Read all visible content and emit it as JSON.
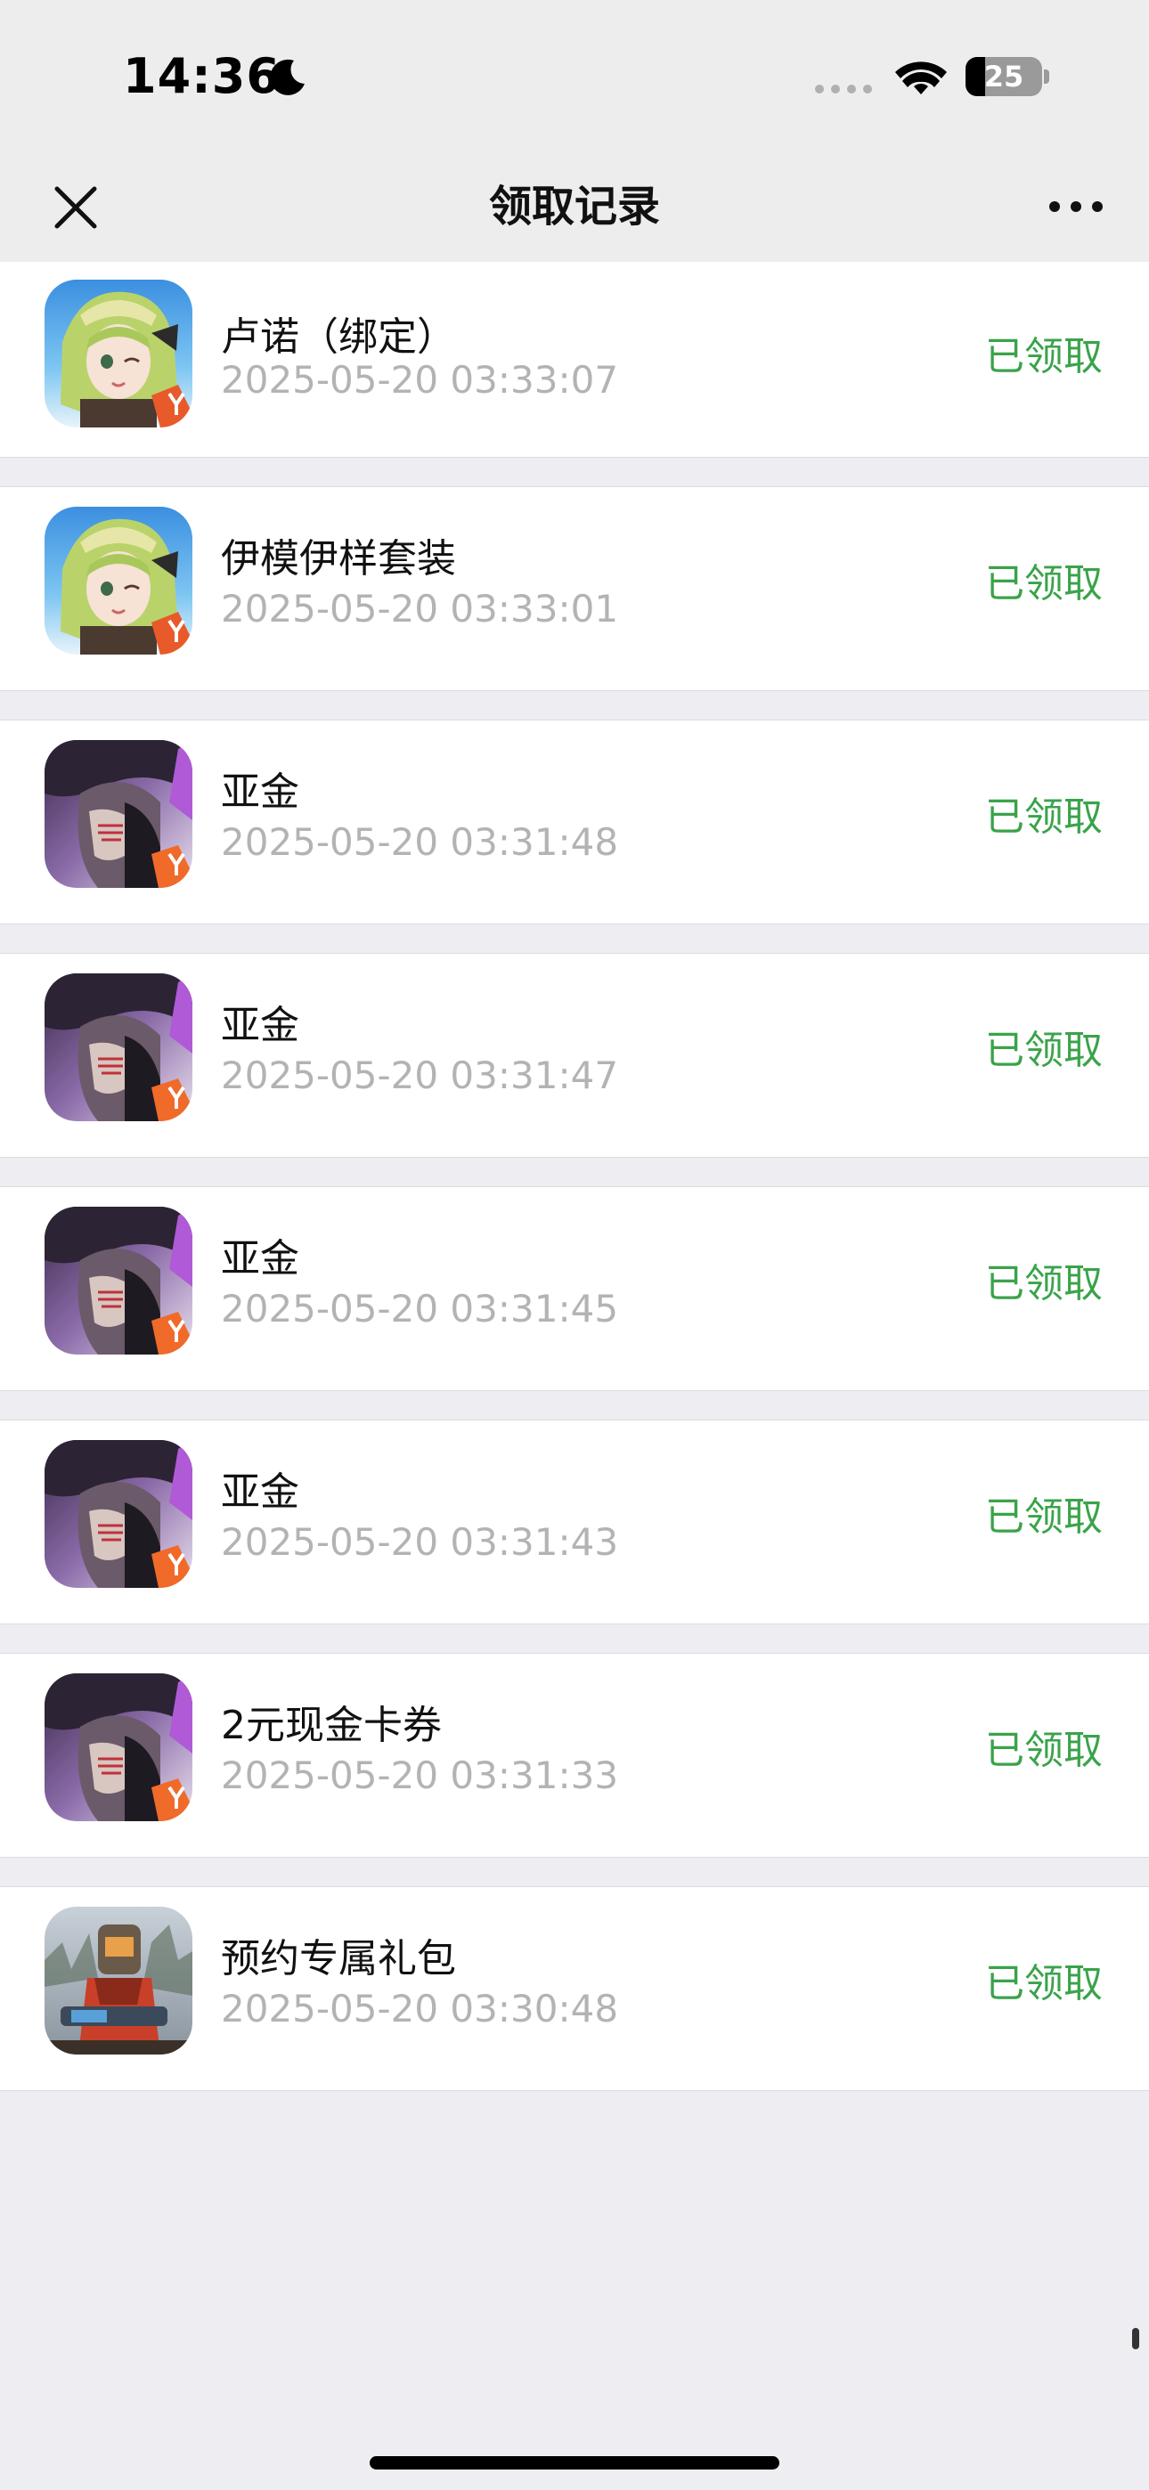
{
  "status_bar": {
    "time": "14:36",
    "battery_level": "25",
    "battery_fraction": 0.25,
    "icons": [
      "moon-icon",
      "signal-icon",
      "wifi-icon",
      "battery-icon"
    ]
  },
  "nav": {
    "title": "领取记录",
    "close_icon": "close-icon",
    "more_icon": "more-icon"
  },
  "records": [
    {
      "title": "卢诺（绑定）",
      "time": "2025-05-20 03:33:07",
      "status": "已领取",
      "icon": "game-icon-anime-girl"
    },
    {
      "title": "伊模伊样套装",
      "time": "2025-05-20 03:33:01",
      "status": "已领取",
      "icon": "game-icon-anime-girl"
    },
    {
      "title": "亚金",
      "time": "2025-05-20 03:31:48",
      "status": "已领取",
      "icon": "game-icon-warrior"
    },
    {
      "title": "亚金",
      "time": "2025-05-20 03:31:47",
      "status": "已领取",
      "icon": "game-icon-warrior"
    },
    {
      "title": "亚金",
      "time": "2025-05-20 03:31:45",
      "status": "已领取",
      "icon": "game-icon-warrior"
    },
    {
      "title": "亚金",
      "time": "2025-05-20 03:31:43",
      "status": "已领取",
      "icon": "game-icon-warrior"
    },
    {
      "title": "2元现金卡券",
      "time": "2025-05-20 03:31:33",
      "status": "已领取",
      "icon": "game-icon-warrior"
    },
    {
      "title": "预约专属礼包",
      "time": "2025-05-20 03:30:48",
      "status": "已领取",
      "icon": "game-icon-soldier"
    }
  ],
  "colors": {
    "status_green": "#3aa34a",
    "time_gray": "#b3b3b3",
    "background": "#ededf2"
  }
}
